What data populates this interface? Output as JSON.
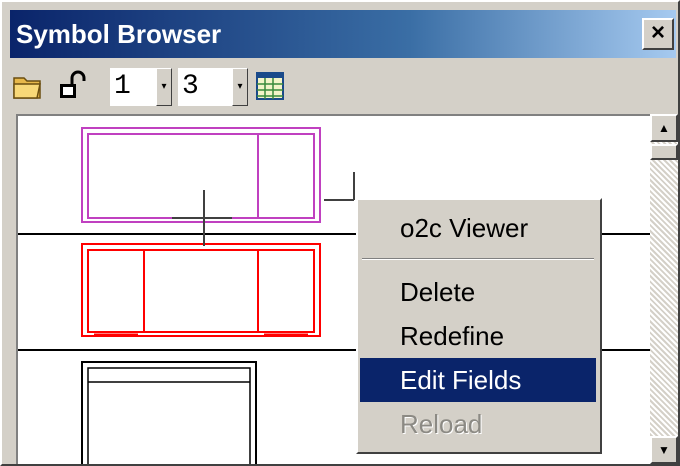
{
  "window": {
    "title": "Symbol Browser",
    "close_glyph": "×"
  },
  "toolbar": {
    "icons": {
      "open": "folder-open-icon",
      "lock": "padlock-open-icon",
      "table": "grid-table-icon"
    },
    "spin1": {
      "value": "1",
      "arrow": "▾"
    },
    "spin2": {
      "value": "3",
      "arrow": "▾"
    }
  },
  "scrollbar": {
    "up": "▲",
    "down": "▼"
  },
  "symbols": [
    {
      "color": "#c040c0"
    },
    {
      "color": "#ff0000"
    },
    {
      "color": "#000000"
    }
  ],
  "context_menu": {
    "items": [
      {
        "label": "o2c Viewer",
        "state": "normal"
      },
      {
        "label": "Delete",
        "state": "normal"
      },
      {
        "label": "Redefine",
        "state": "normal"
      },
      {
        "label": "Edit Fields",
        "state": "selected"
      },
      {
        "label": "Reload",
        "state": "disabled"
      }
    ]
  },
  "colors": {
    "selection": "#0a246a",
    "title_start": "#0a246a",
    "title_end": "#a6caf0"
  }
}
